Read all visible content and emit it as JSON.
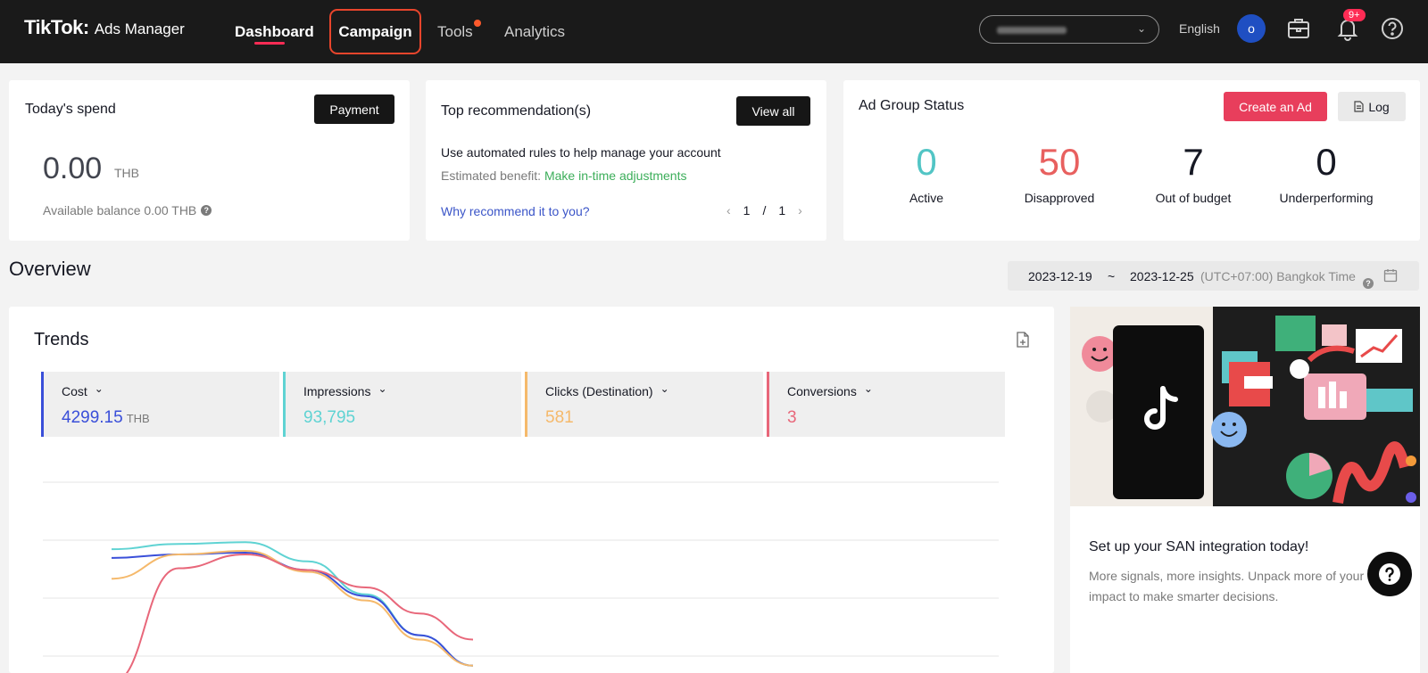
{
  "header": {
    "brand": "TikTok",
    "brand_suffix": ":",
    "product": "Ads Manager",
    "nav": {
      "dashboard": "Dashboard",
      "campaign": "Campaign",
      "tools": "Tools",
      "analytics": "Analytics"
    },
    "language": "English",
    "avatar_initial": "o",
    "notification_badge": "9+",
    "accent_color": "#fe2c55"
  },
  "todays_spend": {
    "title": "Today's spend",
    "payment_button": "Payment",
    "value": "0.00",
    "currency": "THB",
    "balance_label": "Available balance 0.00 THB"
  },
  "recommendations": {
    "title": "Top recommendation(s)",
    "view_all": "View all",
    "text": "Use automated rules to help manage your account",
    "benefit_label": "Estimated benefit:",
    "benefit_value": "Make in-time adjustments",
    "why_link": "Why recommend it to you?",
    "page_current": "1",
    "page_sep": "/",
    "page_total": "1"
  },
  "ad_group_status": {
    "title": "Ad Group Status",
    "create_button": "Create an Ad",
    "log_button": "Log",
    "stats": [
      {
        "value": "0",
        "label": "Active",
        "color": "#52c5c5"
      },
      {
        "value": "50",
        "label": "Disapproved",
        "color": "#e8605f"
      },
      {
        "value": "7",
        "label": "Out of budget",
        "color": "#161823"
      },
      {
        "value": "0",
        "label": "Underperforming",
        "color": "#161823"
      }
    ]
  },
  "overview": {
    "title": "Overview",
    "date_start": "2023-12-19",
    "date_sep": "~",
    "date_end": "2023-12-25",
    "timezone": "(UTC+07:00) Bangkok Time"
  },
  "trends": {
    "title": "Trends",
    "metrics": [
      {
        "label": "Cost",
        "value": "4299.15",
        "unit": "THB",
        "color": "#3a4fd9"
      },
      {
        "label": "Impressions",
        "value": "93,795",
        "unit": "",
        "color": "#5fd3d3"
      },
      {
        "label": "Clicks (Destination)",
        "value": "581",
        "unit": "",
        "color": "#f5b96b"
      },
      {
        "label": "Conversions",
        "value": "3",
        "unit": "",
        "color": "#e8677a"
      }
    ]
  },
  "chart_data": {
    "type": "line",
    "series": [
      {
        "name": "Impressions",
        "values": [
          0.64,
          0.7,
          0.72,
          0.5,
          0.12,
          -0.35,
          -0.7
        ]
      },
      {
        "name": "Cost",
        "values": [
          0.54,
          0.58,
          0.6,
          0.4,
          0.1,
          -0.35,
          -0.7
        ]
      },
      {
        "name": "Clicks (Destination)",
        "values": [
          0.3,
          0.58,
          0.62,
          0.38,
          0.05,
          -0.4,
          -0.7
        ]
      },
      {
        "name": "Conversions",
        "values": [
          -0.9,
          0.42,
          0.58,
          0.4,
          0.2,
          -0.1,
          -0.4
        ]
      }
    ],
    "grid": true
  },
  "promo": {
    "title": "Set up your SAN integration today!",
    "description": "More signals, more insights. Unpack more of your impact to make smarter decisions."
  }
}
